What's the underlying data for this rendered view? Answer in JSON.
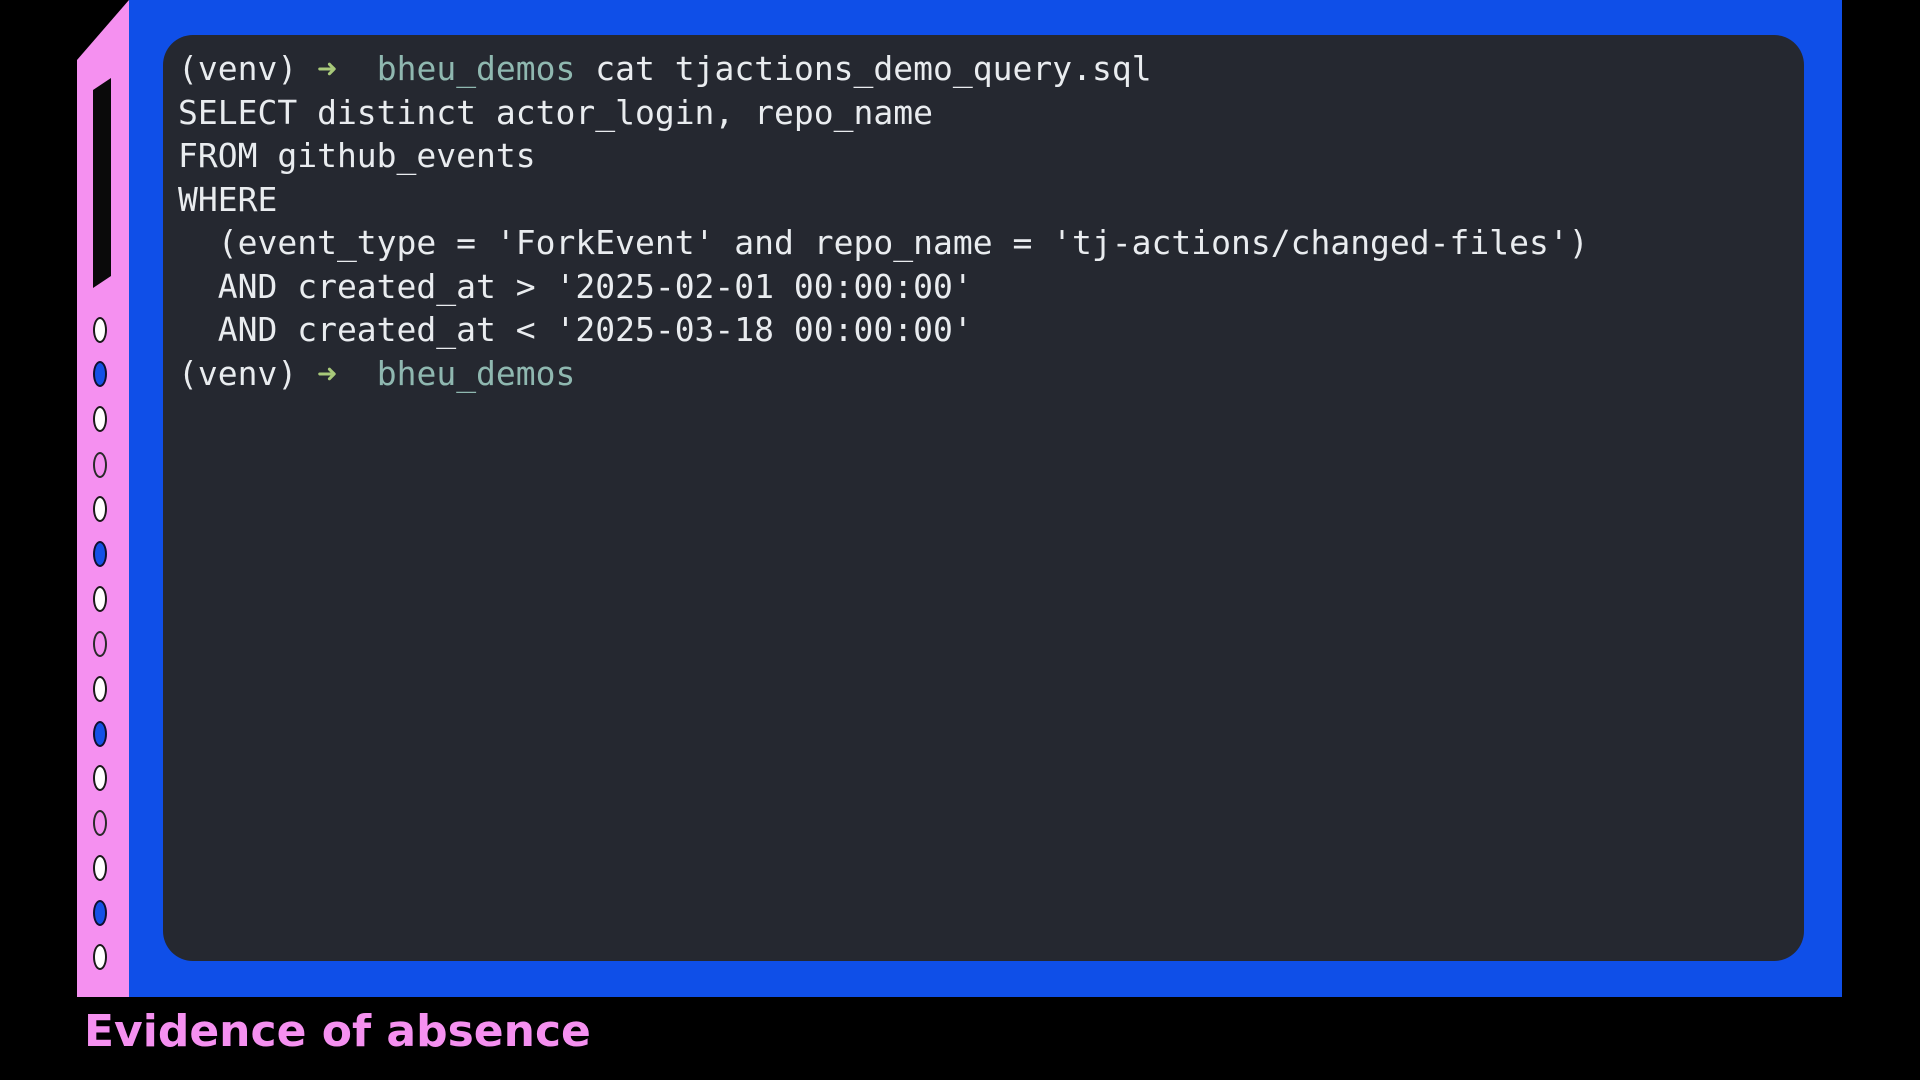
{
  "terminal": {
    "lines": [
      {
        "venv": "(venv)",
        "arrow": "➜",
        "dir": "bheu_demos",
        "cmd": " cat tjactions_demo_query.sql"
      },
      {
        "text": "SELECT distinct actor_login, repo_name"
      },
      {
        "text": "FROM github_events"
      },
      {
        "text": "WHERE"
      },
      {
        "text": "  (event_type = 'ForkEvent' and repo_name = 'tj-actions/changed-files')"
      },
      {
        "text": "  AND created_at > '2025-02-01 00:00:00'"
      },
      {
        "text": "  AND created_at < '2025-03-18 00:00:00'"
      },
      {
        "venv": "(venv)",
        "arrow": "➜",
        "dir": "bheu_demos",
        "cmd": ""
      }
    ]
  },
  "caption": "Evidence of absence",
  "colors": {
    "frame_blue": "#0f4fe8",
    "strip_pink": "#f590f0",
    "terminal_bg": "#252830",
    "prompt_arrow": "#a8c97a",
    "prompt_dir": "#8fb8b0"
  }
}
